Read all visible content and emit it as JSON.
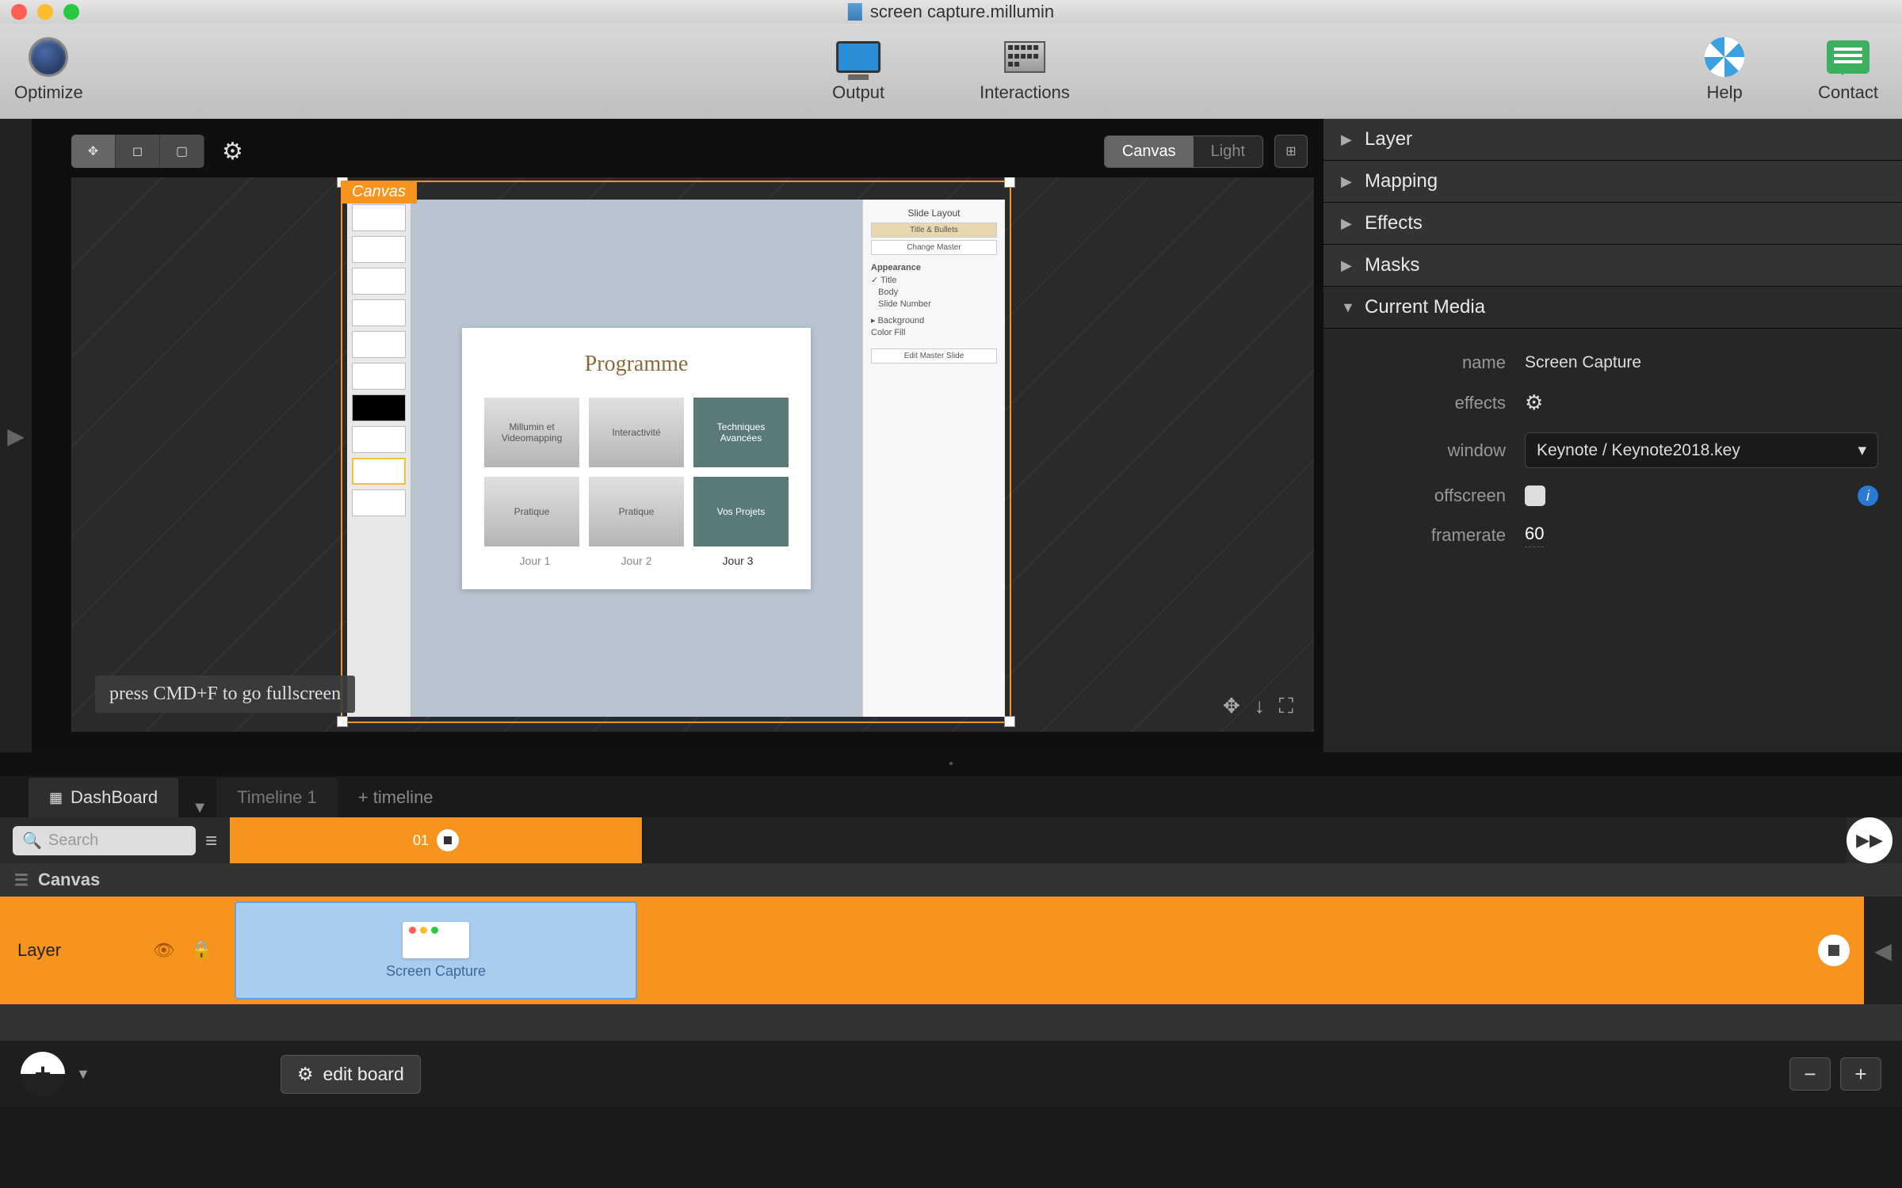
{
  "window": {
    "title": "screen capture.millumin"
  },
  "toolbar": {
    "optimize": "Optimize",
    "output": "Output",
    "interactions": "Interactions",
    "help": "Help",
    "contact": "Contact"
  },
  "canvas": {
    "tool_crop": "crop",
    "tool_frame": "frame",
    "tool_fill": "fill",
    "segment_canvas": "Canvas",
    "segment_light": "Light",
    "label": "Canvas",
    "hint": "press CMD+F to go fullscreen"
  },
  "keynote": {
    "slide_title": "Programme",
    "tiles": [
      "Millumin et Videomapping",
      "Interactivité",
      "Techniques Avancées",
      "Pratique",
      "Pratique",
      "Vos Projets"
    ],
    "days": [
      "Jour 1",
      "Jour 2",
      "Jour 3"
    ],
    "inspector": {
      "section": "Slide Layout",
      "btn1": "Title & Bullets",
      "btn2": "Change Master",
      "appearance": "Appearance",
      "opt_title": "Title",
      "opt_body": "Body",
      "opt_slide_number": "Slide Number",
      "background": "Background",
      "color_fill": "Color Fill",
      "edit_master": "Edit Master Slide"
    }
  },
  "properties": {
    "sections": [
      "Layer",
      "Mapping",
      "Effects",
      "Masks",
      "Current Media"
    ],
    "name_label": "name",
    "name_value": "Screen Capture",
    "effects_label": "effects",
    "window_label": "window",
    "window_value": "Keynote / Keynote2018.key",
    "offscreen_label": "offscreen",
    "framerate_label": "framerate",
    "framerate_value": "60"
  },
  "tabs": {
    "dashboard": "DashBoard",
    "timeline1": "Timeline 1",
    "add": "+ timeline"
  },
  "timeline": {
    "search_placeholder": "Search",
    "column_number": "01",
    "canvas_label": "Canvas",
    "layer_label": "Layer",
    "clip_label": "Screen Capture"
  },
  "bottom": {
    "edit_board": "edit board",
    "minus": "−",
    "plus": "+"
  }
}
